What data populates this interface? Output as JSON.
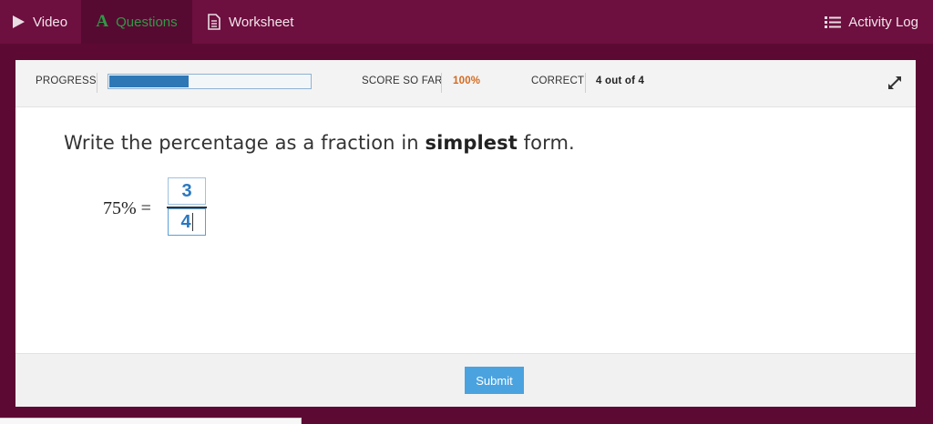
{
  "nav": {
    "items": [
      {
        "label": "Video",
        "icon": "play-icon"
      },
      {
        "label": "Questions",
        "icon": "a-letter-icon",
        "active": true
      },
      {
        "label": "Worksheet",
        "icon": "document-icon"
      }
    ],
    "activity_log": {
      "label": "Activity Log",
      "icon": "list-icon"
    }
  },
  "status": {
    "progress_label": "PROGRESS",
    "progress_fraction": 0.4,
    "score_label": "SCORE SO FAR",
    "score_value": "100%",
    "correct_label": "CORRECT",
    "correct_value": "4 out of 4",
    "expand_icon": "expand-icon"
  },
  "question": {
    "prefix": "Write the percentage as a fraction in ",
    "emphasis": "simplest",
    "suffix": " form."
  },
  "equation": {
    "lhs": "75% =",
    "numerator": "3",
    "denominator": "4"
  },
  "footer": {
    "submit_label": "Submit"
  },
  "colors": {
    "nav_bg": "#6d0f3f",
    "page_bg": "#5c0a33",
    "active_tab_text": "#2f9a46",
    "progress_fill": "#2f78b6",
    "score_value": "#d46a1f",
    "answer_text": "#2a78c0",
    "submit_bg": "#4aa3df"
  }
}
